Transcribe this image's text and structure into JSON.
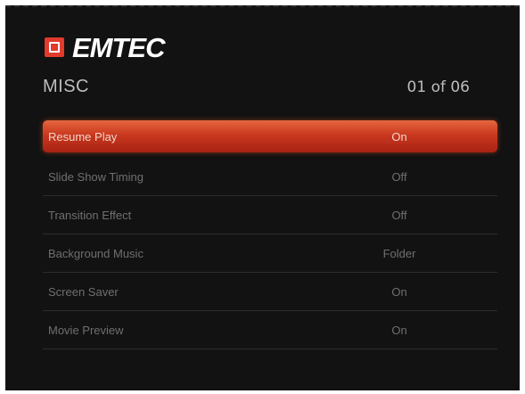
{
  "brand": {
    "name": "EMTEC",
    "accent": "#e23a2c"
  },
  "header": {
    "section_title": "MISC",
    "page_counter": "01 of 06"
  },
  "menu": {
    "selected_index": 0,
    "highlight_color": "#c9381f",
    "items": [
      {
        "label": "Resume Play",
        "value": "On"
      },
      {
        "label": "Slide Show Timing",
        "value": "Off"
      },
      {
        "label": "Transition Effect",
        "value": "Off"
      },
      {
        "label": "Background Music",
        "value": "Folder"
      },
      {
        "label": "Screen Saver",
        "value": "On"
      },
      {
        "label": "Movie Preview",
        "value": "On"
      }
    ]
  }
}
